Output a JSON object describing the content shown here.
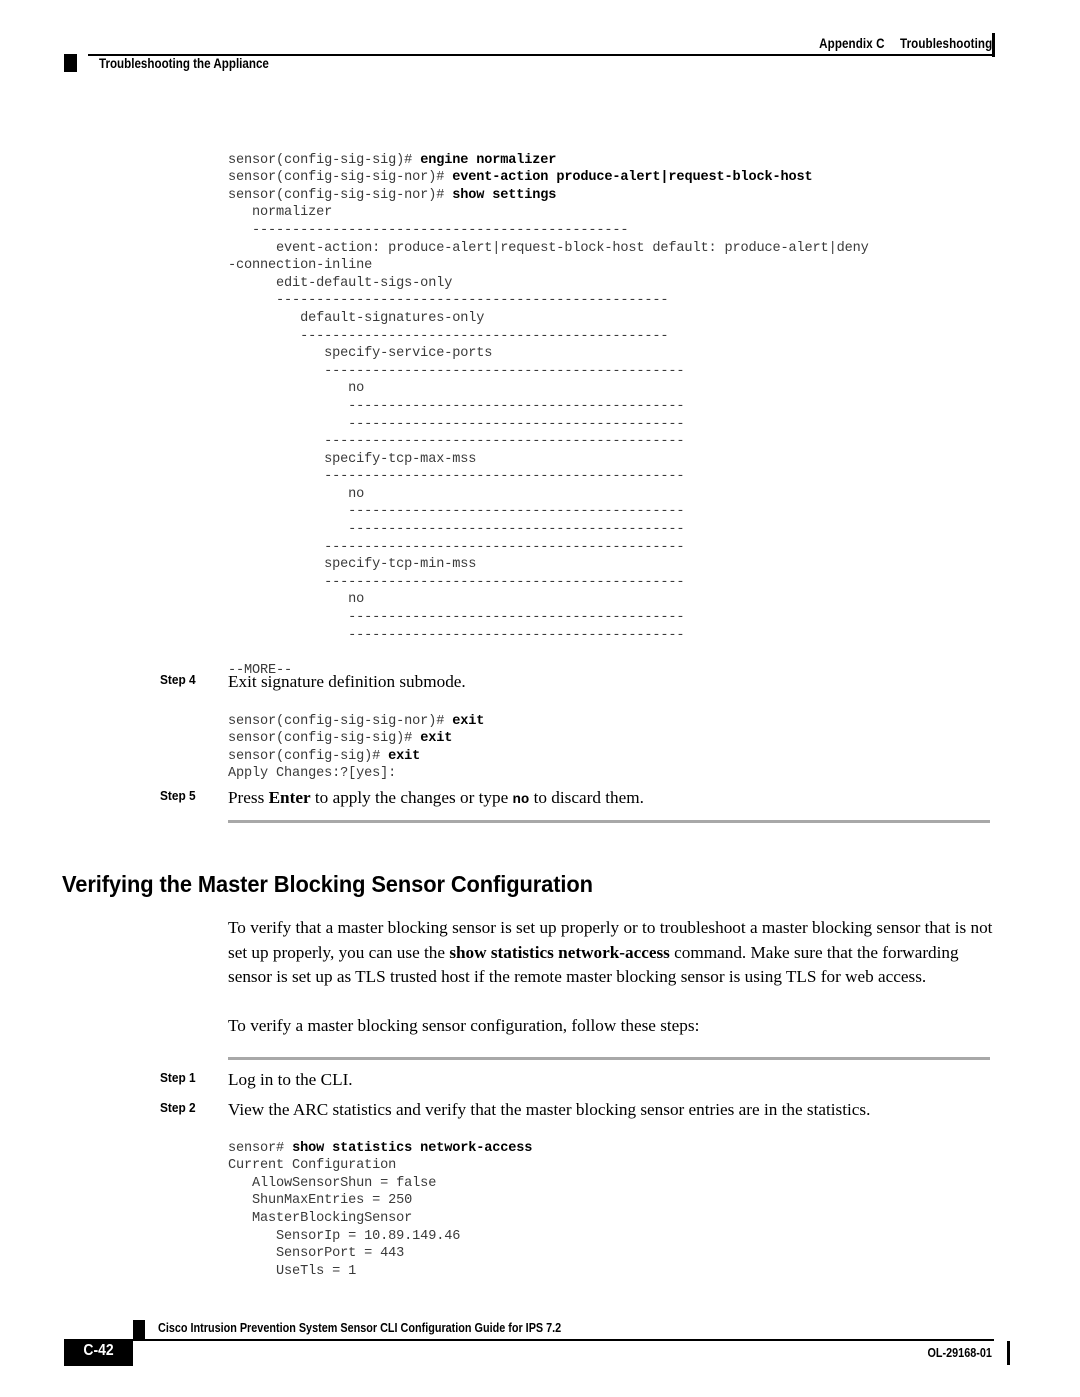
{
  "header": {
    "appendix": "Appendix C",
    "chapter": "Troubleshooting",
    "running_head": "Troubleshooting the Appliance"
  },
  "footer": {
    "guide_title": "Cisco Intrusion Prevention System Sensor CLI Configuration Guide for IPS 7.2",
    "page_number": "C-42",
    "doc_id": "OL-29168-01"
  },
  "code_block_1": {
    "lines": [
      {
        "plain": "sensor(config-sig-sig)# ",
        "bold": "engine normalizer"
      },
      {
        "plain": "sensor(config-sig-sig-nor)# ",
        "bold": "event-action produce-alert|request-block-host"
      },
      {
        "plain": "sensor(config-sig-sig-nor)# ",
        "bold": "show settings"
      },
      {
        "plain": "   normalizer",
        "bold": ""
      },
      {
        "plain": "   -----------------------------------------------",
        "bold": ""
      },
      {
        "plain": "      event-action: produce-alert|request-block-host default: produce-alert|deny",
        "bold": ""
      },
      {
        "plain": "-connection-inline",
        "bold": ""
      },
      {
        "plain": "      edit-default-sigs-only",
        "bold": ""
      },
      {
        "plain": "      -------------------------------------------------",
        "bold": ""
      },
      {
        "plain": "         default-signatures-only",
        "bold": ""
      },
      {
        "plain": "         ----------------------------------------------",
        "bold": ""
      },
      {
        "plain": "            specify-service-ports",
        "bold": ""
      },
      {
        "plain": "            ---------------------------------------------",
        "bold": ""
      },
      {
        "plain": "               no",
        "bold": ""
      },
      {
        "plain": "               ------------------------------------------",
        "bold": ""
      },
      {
        "plain": "               ------------------------------------------",
        "bold": ""
      },
      {
        "plain": "            ---------------------------------------------",
        "bold": ""
      },
      {
        "plain": "            specify-tcp-max-mss",
        "bold": ""
      },
      {
        "plain": "            ---------------------------------------------",
        "bold": ""
      },
      {
        "plain": "               no",
        "bold": ""
      },
      {
        "plain": "               ------------------------------------------",
        "bold": ""
      },
      {
        "plain": "               ------------------------------------------",
        "bold": ""
      },
      {
        "plain": "            ---------------------------------------------",
        "bold": ""
      },
      {
        "plain": "            specify-tcp-min-mss",
        "bold": ""
      },
      {
        "plain": "            ---------------------------------------------",
        "bold": ""
      },
      {
        "plain": "               no",
        "bold": ""
      },
      {
        "plain": "               ------------------------------------------",
        "bold": ""
      },
      {
        "plain": "               ------------------------------------------",
        "bold": ""
      }
    ],
    "more_prompt": "--MORE--"
  },
  "step4": {
    "label": "Step 4",
    "text": "Exit signature definition submode."
  },
  "code_block_2": {
    "lines": [
      {
        "plain": "sensor(config-sig-sig-nor)# ",
        "bold": "exit"
      },
      {
        "plain": "sensor(config-sig-sig)# ",
        "bold": "exit"
      },
      {
        "plain": "sensor(config-sig)# ",
        "bold": "exit"
      },
      {
        "plain": "Apply Changes:?[yes]:",
        "bold": ""
      }
    ]
  },
  "step5": {
    "label": "Step 5",
    "text_part1": "Press ",
    "text_bold": "Enter",
    "text_part2": " to apply the changes or type ",
    "text_mono": "no",
    "text_part3": " to discard them."
  },
  "section": {
    "title": "Verifying the Master Blocking Sensor Configuration",
    "paragraph1_part1": "To verify that a master blocking sensor is set up properly or to troubleshoot a master blocking sensor that is not set up properly, you can use the ",
    "paragraph1_bold": "show statistics network-access",
    "paragraph1_part2": " command. Make sure that the forwarding sensor is set up as TLS trusted host if the remote master blocking sensor is using TLS for web access.",
    "paragraph2": "To verify a master blocking sensor configuration, follow these steps:"
  },
  "step1": {
    "label": "Step 1",
    "text": "Log in to the CLI."
  },
  "step2": {
    "label": "Step 2",
    "text": "View the ARC statistics and verify that the master blocking sensor entries are in the statistics."
  },
  "code_block_3": {
    "lines": [
      {
        "plain": "sensor# ",
        "bold": "show statistics network-access"
      },
      {
        "plain": "Current Configuration",
        "bold": ""
      },
      {
        "plain": "   AllowSensorShun = false",
        "bold": ""
      },
      {
        "plain": "   ShunMaxEntries = 250",
        "bold": ""
      },
      {
        "plain": "   MasterBlockingSensor",
        "bold": ""
      },
      {
        "plain": "      SensorIp = 10.89.149.46",
        "bold": ""
      },
      {
        "plain": "      SensorPort = 443",
        "bold": ""
      },
      {
        "plain": "      UseTls = 1",
        "bold": ""
      }
    ]
  }
}
